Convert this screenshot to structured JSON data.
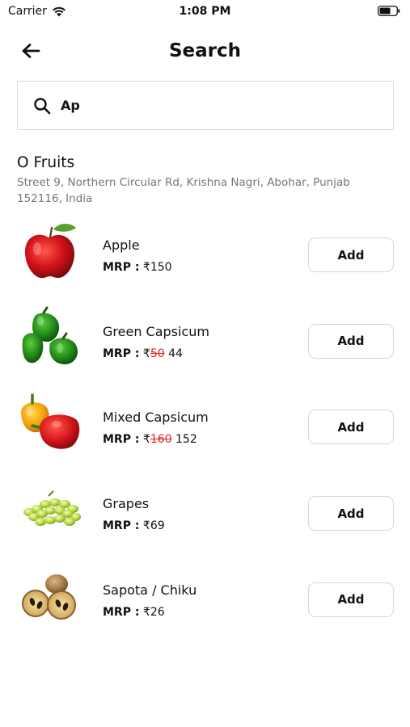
{
  "status_bar": {
    "carrier": "Carrier",
    "time": "1:08 PM"
  },
  "header": {
    "title": "Search"
  },
  "search": {
    "value": "Ap"
  },
  "store": {
    "name": "O Fruits",
    "address": "Street 9, Northern Circular Rd, Krishna Nagri, Abohar, Punjab 152116, India"
  },
  "products": [
    {
      "name": "Apple",
      "mrp_label": "MRP :",
      "currency": "₹",
      "old_price": "",
      "price": "150",
      "button": "Add",
      "image_icon": "apple-icon"
    },
    {
      "name": "Green Capsicum",
      "mrp_label": "MRP :",
      "currency": "₹",
      "old_price": "50",
      "price": "44",
      "button": "Add",
      "image_icon": "green-capsicum-icon"
    },
    {
      "name": "Mixed Capsicum",
      "mrp_label": "MRP :",
      "currency": "₹",
      "old_price": "160",
      "price": "152",
      "button": "Add",
      "image_icon": "mixed-capsicum-icon"
    },
    {
      "name": "Grapes",
      "mrp_label": "MRP :",
      "currency": "₹",
      "old_price": "",
      "price": "69",
      "button": "Add",
      "image_icon": "grapes-icon"
    },
    {
      "name": "Sapota / Chiku",
      "mrp_label": "MRP :",
      "currency": "₹",
      "old_price": "",
      "price": "26",
      "button": "Add",
      "image_icon": "sapota-icon"
    }
  ],
  "colors": {
    "strike": "#e0211b",
    "border": "#d6d6d6",
    "address_gray": "#777777"
  }
}
